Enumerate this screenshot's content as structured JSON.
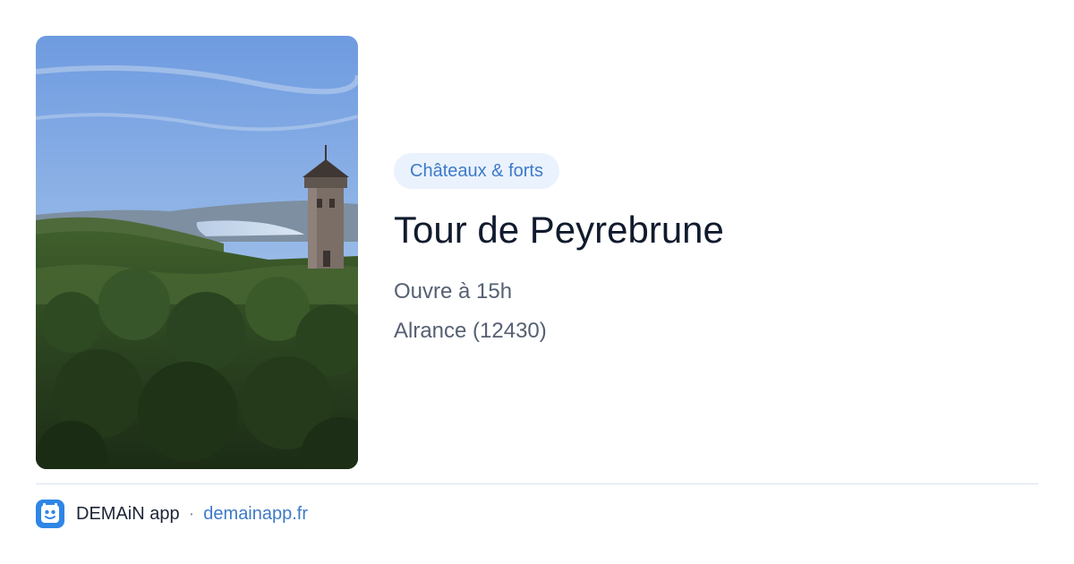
{
  "card": {
    "category": "Châteaux & forts",
    "title": "Tour de Peyrebrune",
    "opening": "Ouvre à 15h",
    "location": "Alrance (12430)"
  },
  "photo": {
    "subject": "tower-over-forest-icon"
  },
  "footer": {
    "app_name": "DEMAiN app",
    "separator": "·",
    "domain": "demainapp.fr",
    "app_icon": "demain-app-icon"
  },
  "colors": {
    "accent": "#3d7ac9",
    "pill_background": "#eaf2fd",
    "title": "#111b2e",
    "detail": "#566073",
    "app_icon": "#2f86e6"
  }
}
